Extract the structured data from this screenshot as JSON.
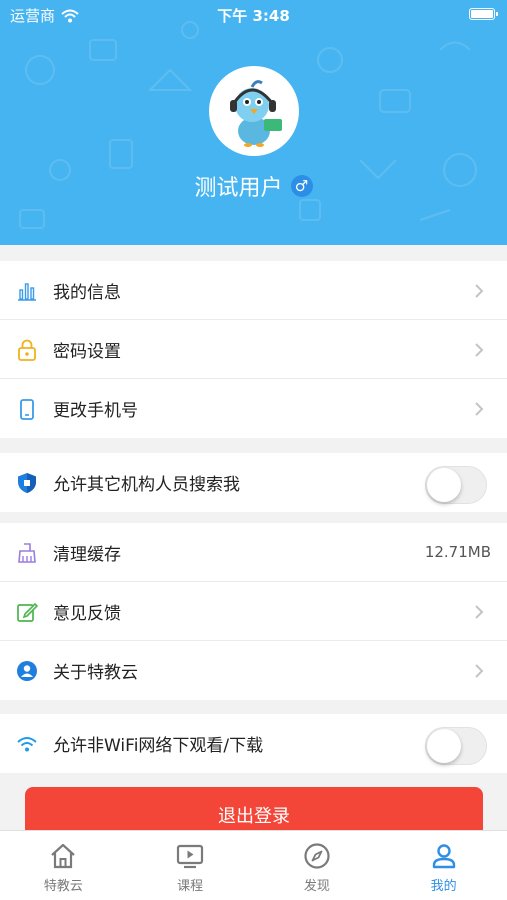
{
  "status_bar": {
    "carrier": "运营商",
    "time": "下午 3:48"
  },
  "profile": {
    "username": "测试用户",
    "gender_symbol": "♂"
  },
  "groups": {
    "account": [
      {
        "label": "我的信息",
        "icon": "bar-chart-icon"
      },
      {
        "label": "密码设置",
        "icon": "lock-icon"
      },
      {
        "label": "更改手机号",
        "icon": "phone-icon"
      }
    ],
    "privacy": {
      "label": "允许其它机构人员搜索我",
      "icon": "shield-icon",
      "toggle_on": false
    },
    "misc": [
      {
        "label": "清理缓存",
        "icon": "broom-icon",
        "value": "12.71MB"
      },
      {
        "label": "意见反馈",
        "icon": "edit-icon"
      },
      {
        "label": "关于特教云",
        "icon": "user-circle-icon"
      }
    ],
    "network": {
      "label": "允许非WiFi网络下观看/下载",
      "icon": "wifi-icon",
      "toggle_on": false
    }
  },
  "logout_label": "退出登录",
  "tabs": [
    {
      "label": "特教云",
      "icon": "home-icon",
      "active": false
    },
    {
      "label": "课程",
      "icon": "tv-play-icon",
      "active": false
    },
    {
      "label": "发现",
      "icon": "compass-icon",
      "active": false
    },
    {
      "label": "我的",
      "icon": "person-icon",
      "active": true
    }
  ],
  "colors": {
    "header": "#46b4f0",
    "accent": "#2f8fe6",
    "logout": "#f34638"
  }
}
